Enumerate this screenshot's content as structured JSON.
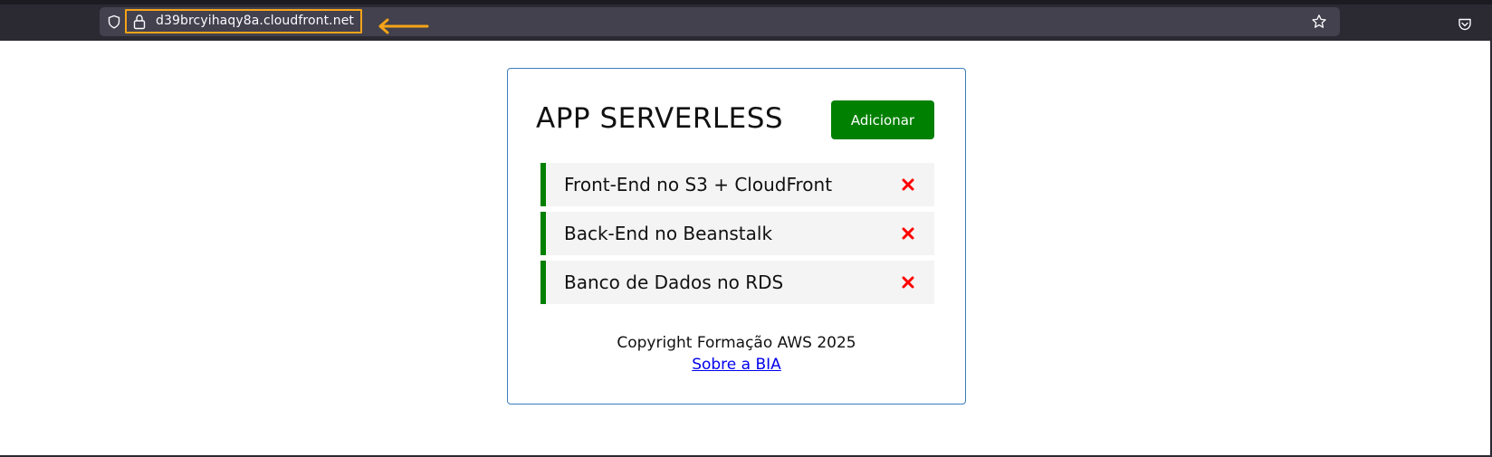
{
  "browser": {
    "url": "d39brcyihaqy8a.cloudfront.net",
    "icons": {
      "tracking": "shield-icon",
      "security": "lock-icon",
      "bookmark": "star-icon",
      "pocket": "pocket-icon",
      "annotation": "arrow-left-icon"
    },
    "highlight_color": "#f5a418"
  },
  "app": {
    "title": "APP SERVERLESS",
    "add_label": "Adicionar",
    "accent_color": "#008000",
    "delete_color": "#ff0000",
    "tasks": [
      {
        "label": "Front-End no S3 + CloudFront"
      },
      {
        "label": "Back-End no Beanstalk"
      },
      {
        "label": "Banco de Dados no RDS"
      }
    ],
    "footer": {
      "copyright": "Copyright Formação AWS 2025",
      "link": "Sobre a BIA"
    }
  }
}
